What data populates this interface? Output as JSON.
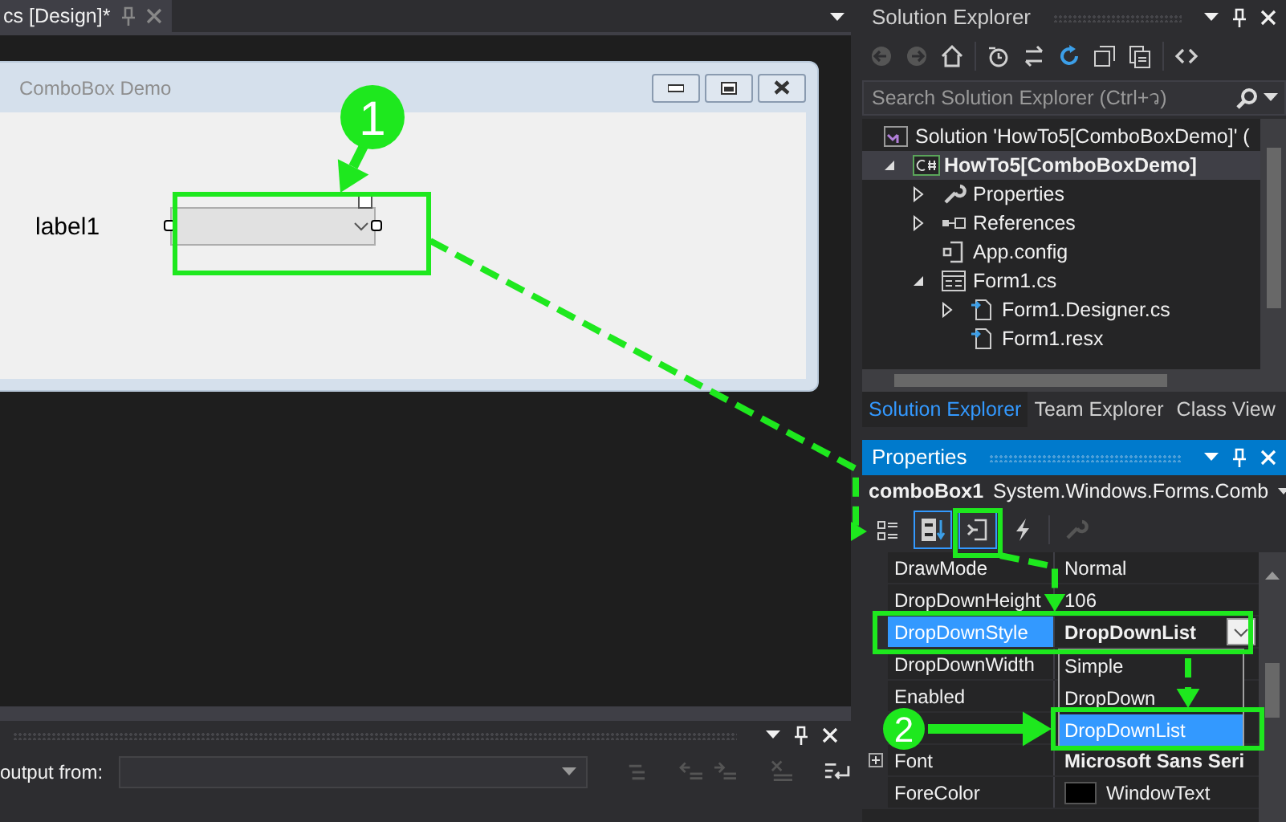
{
  "editor_tab": {
    "title": "cs [Design]*",
    "selected": true
  },
  "form": {
    "title": "ComboBox Demo",
    "label": "label1"
  },
  "solution_explorer": {
    "title": "Solution Explorer",
    "toolbar": [
      {
        "kind": "back",
        "disabled": true
      },
      {
        "kind": "forward",
        "disabled": true
      },
      {
        "kind": "home",
        "disabled": false
      },
      {
        "kind": "history",
        "disabled": false
      },
      {
        "kind": "sync",
        "disabled": false
      },
      {
        "kind": "refresh",
        "disabled": false
      },
      {
        "kind": "collapse",
        "disabled": false
      },
      {
        "kind": "copy",
        "disabled": false
      },
      {
        "kind": "code",
        "disabled": false
      }
    ],
    "search": {
      "placeholder": "Search Solution Explorer (Ctrl+ว)"
    },
    "tree": [
      {
        "kind": "solution",
        "label": "Solution 'HowTo5[ComboBoxDemo]' (",
        "selected": false,
        "children": [
          {
            "kind": "project",
            "label": "HowTo5[ComboBoxDemo]",
            "selected": true,
            "expanded": true,
            "children": [
              {
                "kind": "wrench",
                "label": "Properties",
                "selected": false,
                "expanded": false
              },
              {
                "kind": "references",
                "label": "References",
                "selected": false,
                "expanded": false
              },
              {
                "kind": "config",
                "label": "App.config",
                "selected": false
              },
              {
                "kind": "form",
                "label": "Form1.cs",
                "selected": false,
                "expanded": true,
                "children": [
                  {
                    "kind": "file",
                    "label": "Form1.Designer.cs",
                    "selected": false,
                    "expanded": false
                  },
                  {
                    "kind": "file",
                    "label": "Form1.resx",
                    "selected": false
                  }
                ]
              }
            ]
          }
        ]
      }
    ],
    "tabs": [
      {
        "label": "Solution Explorer",
        "selected": true
      },
      {
        "label": "Team Explorer",
        "selected": false
      },
      {
        "label": "Class View",
        "selected": false
      }
    ]
  },
  "properties": {
    "title": "Properties",
    "object_name": "comboBox1",
    "object_type": "System.Windows.Forms.Comb",
    "toolbar": [
      {
        "kind": "categorized",
        "selected": false,
        "disabled": false
      },
      {
        "kind": "alphabetical",
        "selected": true,
        "disabled": false
      },
      {
        "kind": "properties",
        "selected": true,
        "disabled": false
      },
      {
        "kind": "events",
        "selected": false,
        "disabled": false
      },
      {
        "kind": "pages",
        "selected": false,
        "disabled": true
      }
    ],
    "rows": [
      {
        "name": "DrawMode",
        "value": "Normal",
        "selected": false,
        "modified": false,
        "expandable": false
      },
      {
        "name": "DropDownHeight",
        "value": "106",
        "selected": false,
        "modified": false,
        "expandable": false
      },
      {
        "name": "DropDownStyle",
        "value": "DropDownList",
        "selected": true,
        "modified": true,
        "expandable": false
      },
      {
        "name": "DropDownWidth",
        "selected": false,
        "expandable": false
      },
      {
        "name": "Enabled",
        "selected": false,
        "expandable": false
      },
      {
        "selected": false,
        "expandable": false
      },
      {
        "name": "Font",
        "value": "Microsoft Sans Seri",
        "selected": false,
        "modified": true,
        "expandable": true
      },
      {
        "name": "ForeColor",
        "value": "WindowText",
        "color": "#000000",
        "selected": false,
        "modified": false,
        "expandable": false
      }
    ],
    "dropdown": [
      {
        "label": "Simple",
        "selected": false
      },
      {
        "label": "DropDown",
        "selected": false
      },
      {
        "label": "DropDownList",
        "selected": true
      }
    ]
  },
  "output": {
    "source_label": "output from:"
  },
  "callouts": [
    {
      "label": "1"
    },
    {
      "label": "2"
    }
  ]
}
